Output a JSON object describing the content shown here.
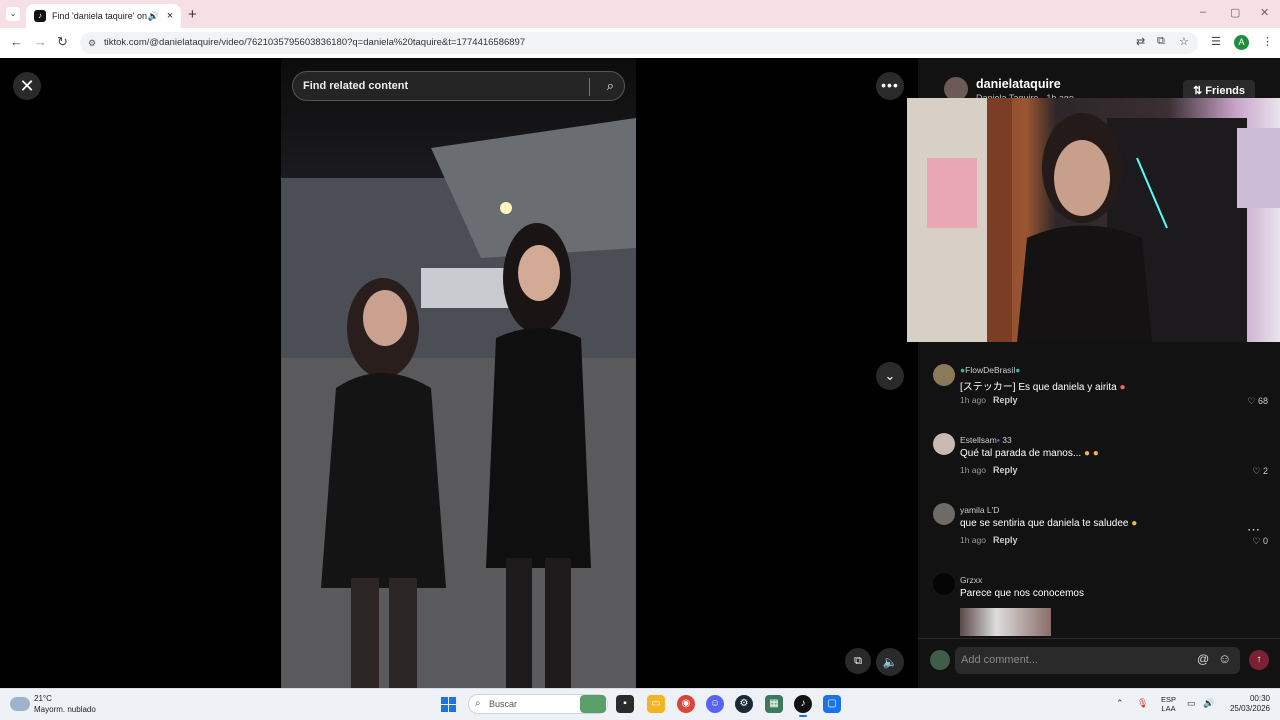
{
  "browser": {
    "tab_title": "Find 'daniela taquire' on Ti",
    "url": "tiktok.com/@danielataquire/video/7621035795603836180?q=daniela%20taquire&t=1774416586897",
    "new_tab": "+",
    "icons": [
      "tab-list-icon",
      "audio-icon",
      "close-tab-icon",
      "back-icon",
      "forward-icon",
      "reload-icon",
      "site-info-icon",
      "translate-icon",
      "install-icon",
      "bookmark-star-icon",
      "extensions-icon",
      "menu-icon"
    ],
    "profile_initial": "A"
  },
  "tiktok": {
    "search_placeholder": "Find related content",
    "author": {
      "username": "danielataquire",
      "display_name": "Daniela Taquire",
      "time": "1h ago"
    },
    "friends_label": "Friends",
    "comments": [
      {
        "user": "FlowDeBrasil",
        "text": "[ステッカー] Es que daniela y airita",
        "time": "1h ago",
        "reply": "Reply",
        "likes": "68"
      },
      {
        "user": "Estellsam",
        "user_suffix": "33",
        "text": "Qué tal parada de manos...",
        "time": "1h ago",
        "reply": "Reply",
        "likes": "2"
      },
      {
        "user": "yamila L'D",
        "text": "que se sentiria que daniela te saludee",
        "time": "1h ago",
        "reply": "Reply",
        "likes": "0"
      },
      {
        "user": "Grzxx",
        "text": "Parece que nos conocemos"
      }
    ],
    "comment_placeholder": "Add comment...",
    "at_symbol": "@"
  },
  "taskbar": {
    "weather_temp": "21°C",
    "weather_desc": "Mayorm. nublado",
    "search_label": "Buscar",
    "lang_top": "ESP",
    "lang_bottom": "LAA",
    "time": "00:30",
    "date": "25/03/2026"
  },
  "colors": {
    "titlebar_bg": "#f7dfe6",
    "page_bg": "#000000",
    "panel_bg": "#121212",
    "send_button": "#7a2234",
    "windows_blue": "#1a73e8"
  }
}
